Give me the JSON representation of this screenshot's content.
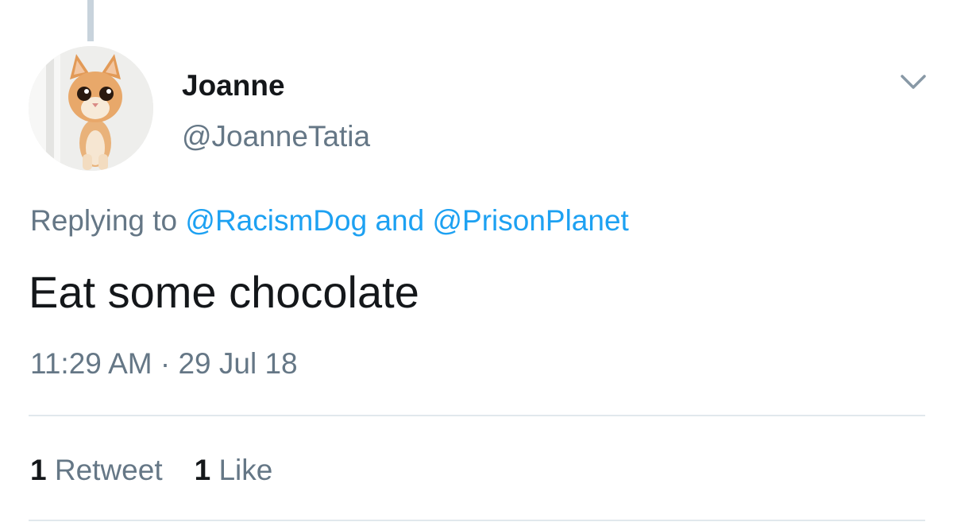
{
  "tweet": {
    "display_name": "Joanne",
    "handle": "@JoanneTatia",
    "reply_prefix": "Replying to ",
    "reply_mention_1": "@RacismDog",
    "reply_joiner": "and",
    "reply_mention_2": "@PrisonPlanet",
    "text": "Eat some chocolate",
    "timestamp": "11:29 AM · 29 Jul 18",
    "retweet_count": "1",
    "retweet_label": "Retweet",
    "like_count": "1",
    "like_label": "Like"
  },
  "icons": {
    "menu": "chevron-down-icon",
    "avatar": "kitten-avatar"
  },
  "colors": {
    "text_primary": "#14171a",
    "text_secondary": "#657786",
    "link": "#1da1f2",
    "divider": "#e1e8ed",
    "thread_line": "#c8d3dc"
  }
}
